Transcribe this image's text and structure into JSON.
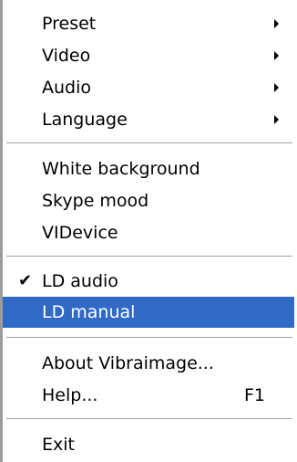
{
  "menu": {
    "submenus": [
      {
        "label": "Preset"
      },
      {
        "label": "Video"
      },
      {
        "label": "Audio"
      },
      {
        "label": "Language"
      }
    ],
    "view_items": [
      {
        "label": "White background"
      },
      {
        "label": "Skype mood"
      },
      {
        "label": "VIDevice"
      }
    ],
    "ld_items": [
      {
        "label": "LD audio",
        "checked": true,
        "check_glyph": "✔"
      },
      {
        "label": "LD manual",
        "highlighted": true
      }
    ],
    "info_items": [
      {
        "label": "About Vibraimage..."
      },
      {
        "label": "Help...",
        "shortcut": "F1"
      }
    ],
    "exit_item": {
      "label": "Exit"
    },
    "colors": {
      "highlight": "#316ac5",
      "highlight_text": "#ffffff",
      "separator": "#a0a0a0"
    }
  }
}
